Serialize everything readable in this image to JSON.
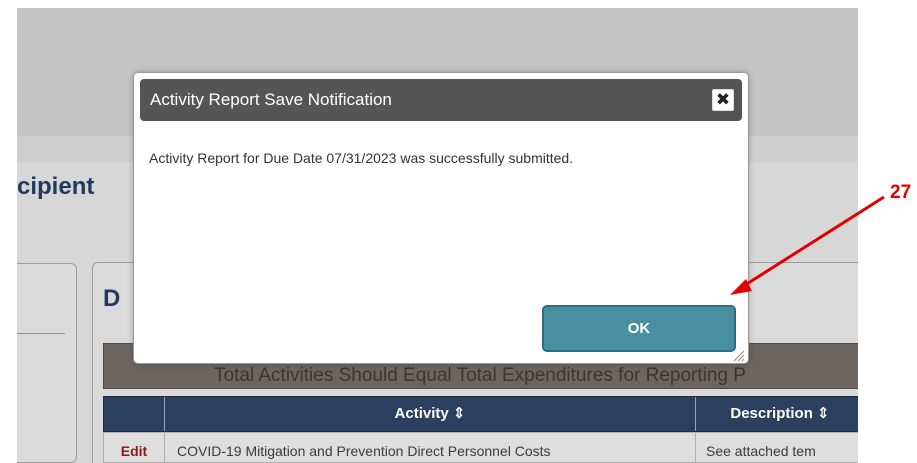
{
  "page": {
    "heading_fragment": "cipient",
    "section_heading_fragment": "D",
    "banner_text": "Total Activities Should Equal Total Expenditures for Reporting P",
    "table": {
      "headers": [
        "",
        "Activity ⇕",
        "Description ⇕"
      ],
      "rows": [
        [
          "Edit",
          "COVID-19 Mitigation and Prevention Direct Personnel Costs",
          "See attached tem"
        ]
      ]
    }
  },
  "dialog": {
    "title": "Activity Report Save Notification",
    "close_glyph": "✖",
    "message": "Activity Report for Due Date 07/31/2023 was successfully submitted.",
    "ok_label": "OK"
  },
  "annotation": {
    "number": "27",
    "color": "#e00000"
  },
  "colors": {
    "dialog_titlebar": "#555555",
    "ok_button": "#4a8fa0",
    "table_header": "#2b3f5f",
    "heading": "#1f3a5b"
  }
}
